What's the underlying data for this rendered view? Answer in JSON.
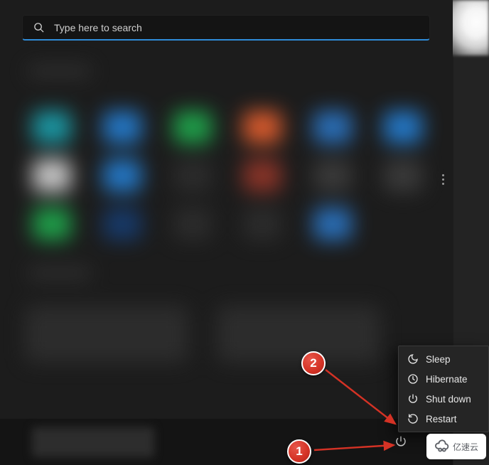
{
  "search": {
    "placeholder": "Type here to search"
  },
  "power_menu": {
    "items": [
      {
        "id": "sleep",
        "label": "Sleep"
      },
      {
        "id": "hibernate",
        "label": "Hibernate"
      },
      {
        "id": "shutdown",
        "label": "Shut down"
      },
      {
        "id": "restart",
        "label": "Restart"
      }
    ]
  },
  "annotations": {
    "badge1": "1",
    "badge2": "2"
  },
  "watermark": {
    "text": "亿速云"
  },
  "colors": {
    "accent": "#2f8cd8",
    "panel_bg": "#1c1c1c",
    "menu_bg": "#252525",
    "badge": "#d43225"
  }
}
